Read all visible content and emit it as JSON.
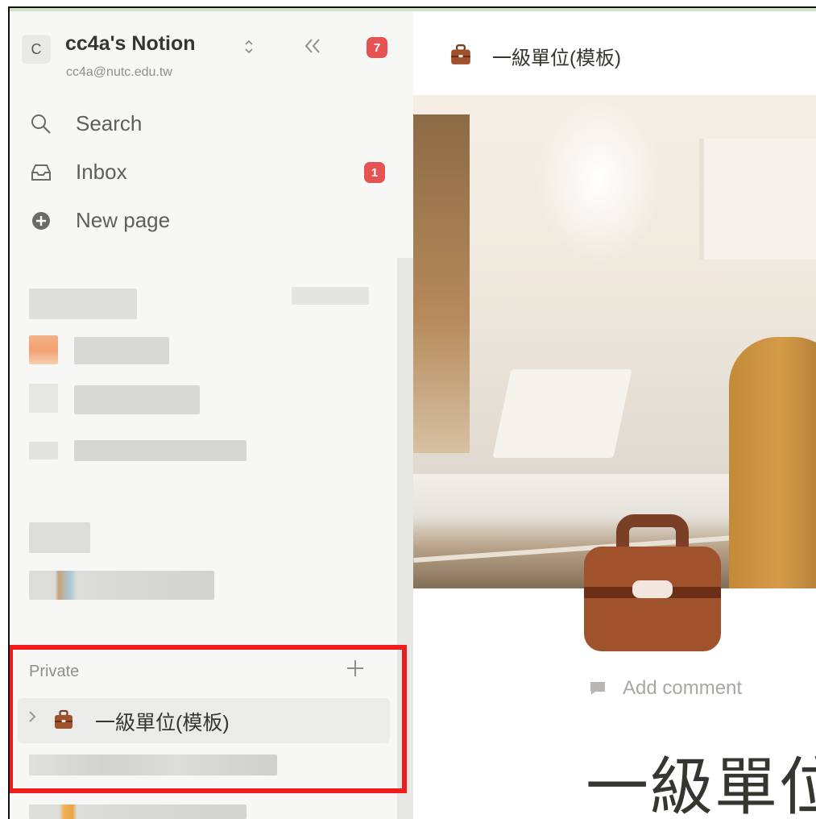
{
  "workspace": {
    "avatar_letter": "C",
    "name": "cc4a's Notion",
    "email": "cc4a@nutc.edu.tw",
    "switch_icon": "chevron-up-down-icon",
    "collapse_icon": "double-chevron-left-icon",
    "notification_count": "7"
  },
  "sidebar": {
    "nav": [
      {
        "label": "Search",
        "icon": "search-icon"
      },
      {
        "label": "Inbox",
        "icon": "inbox-icon",
        "badge": "1"
      },
      {
        "label": "New page",
        "icon": "plus-circle-icon"
      }
    ],
    "private": {
      "label": "Private",
      "add_icon": "plus-icon",
      "pages": [
        {
          "label": "一級單位(模板)",
          "icon": "briefcase-icon"
        }
      ]
    }
  },
  "main": {
    "breadcrumb": {
      "label": "一級單位(模板)",
      "icon": "briefcase-icon"
    },
    "cover_image": "office-desk-cover",
    "page_icon": "briefcase-icon",
    "add_comment_label": "Add comment",
    "title": "一級單位"
  },
  "colors": {
    "sidebar_bg": "#f7f7f5",
    "badge_red": "#e55353",
    "highlight_red": "#ee1c1c",
    "briefcase_brown": "#a0522d"
  }
}
